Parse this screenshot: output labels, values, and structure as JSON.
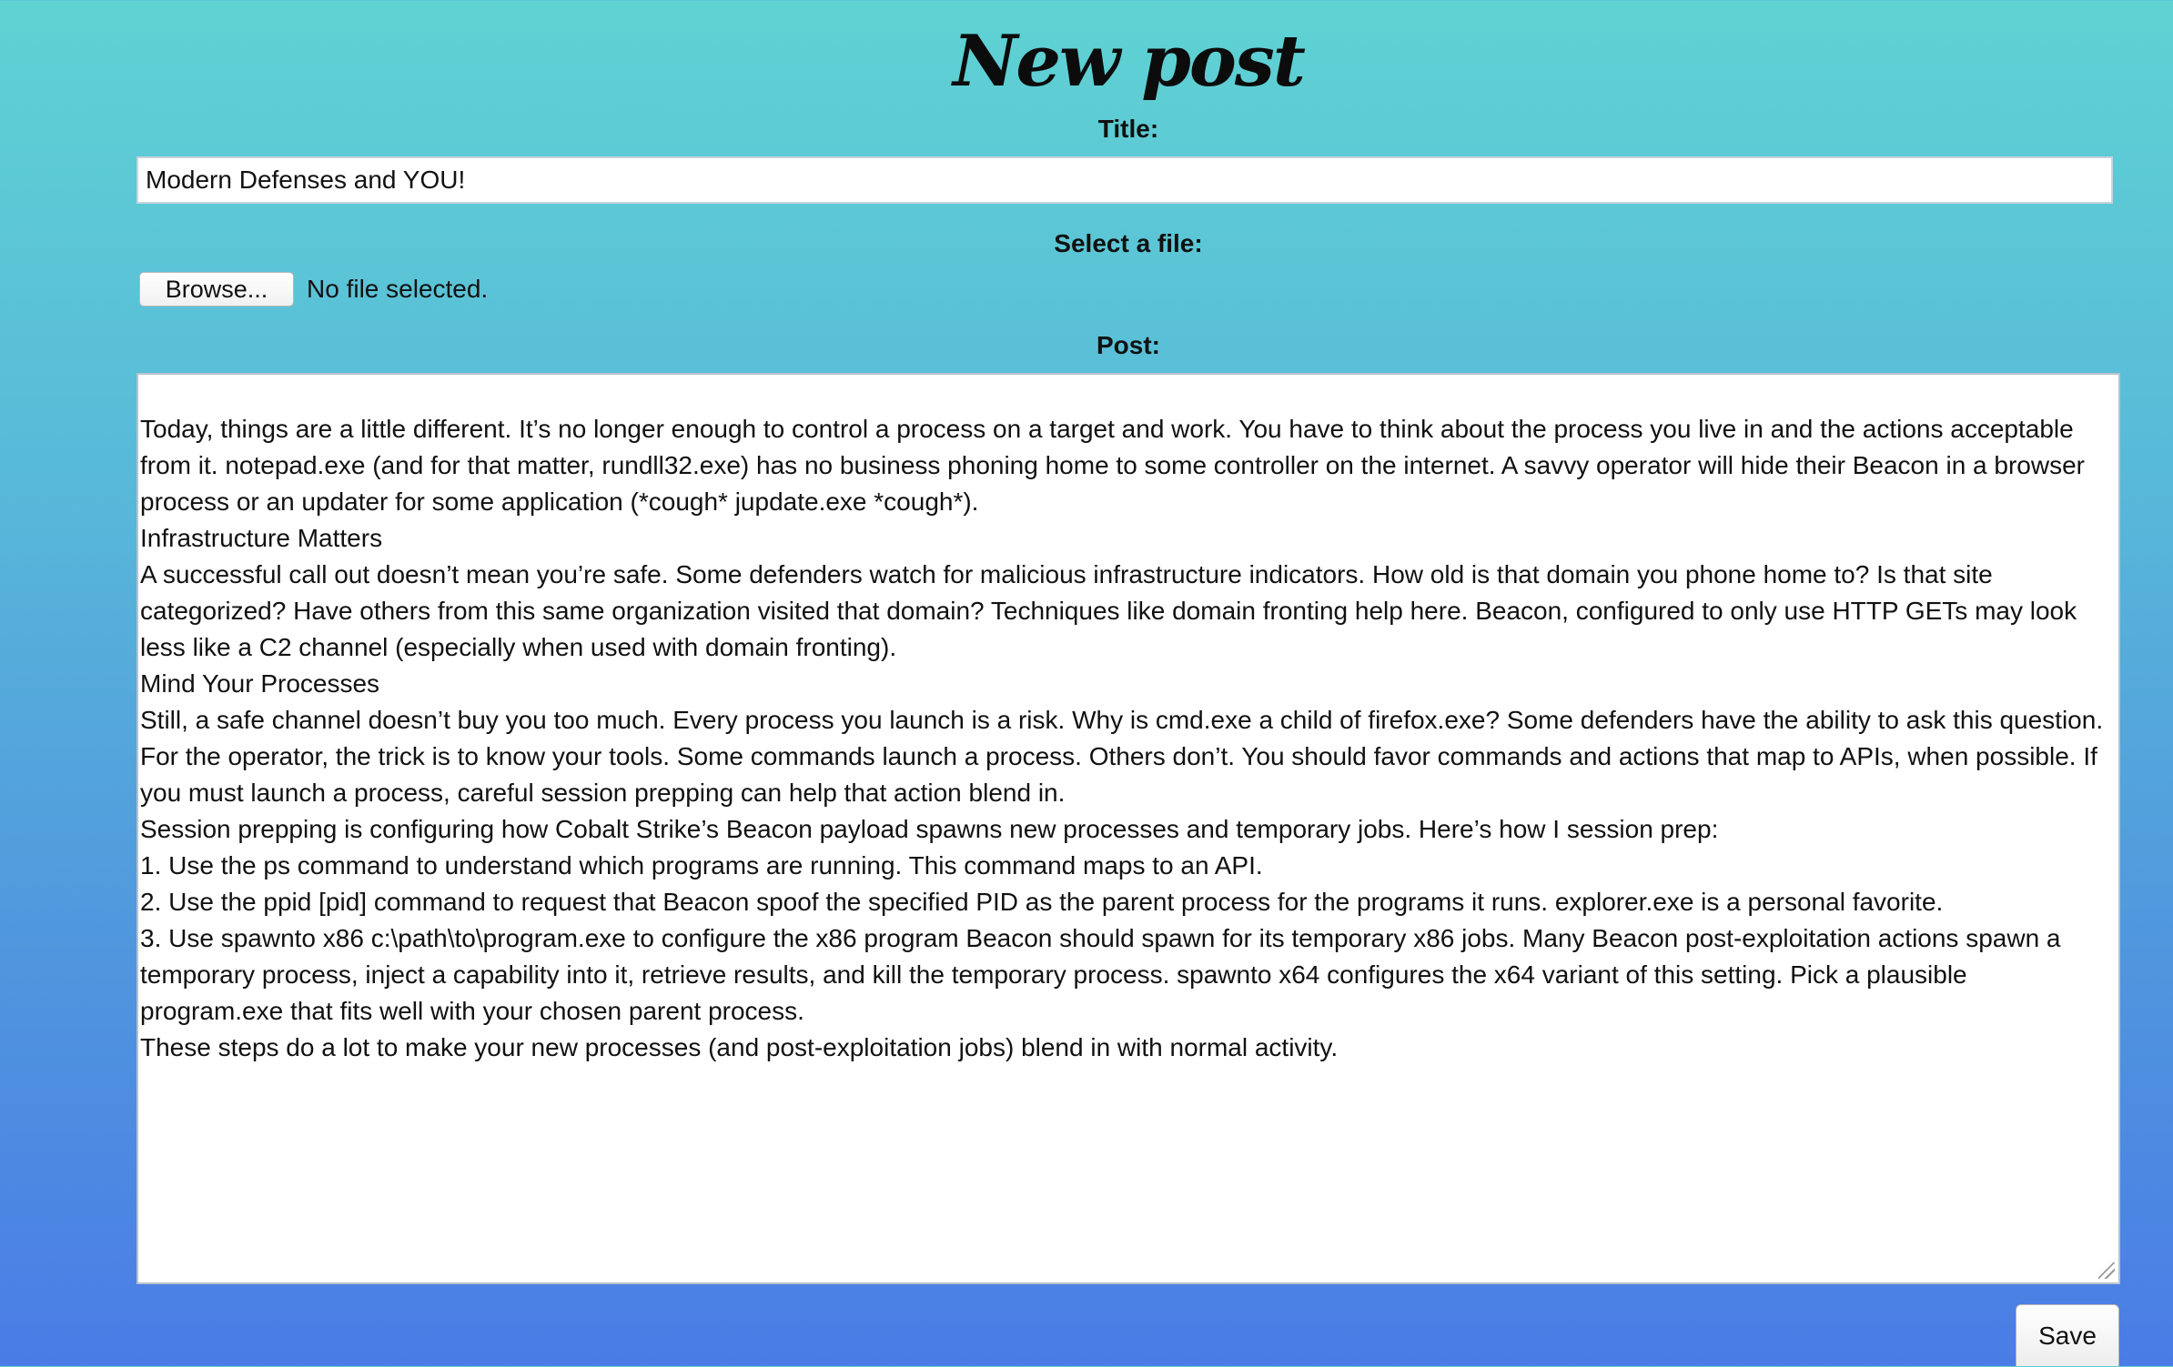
{
  "header": {
    "title": "New post"
  },
  "form": {
    "title_label": "Title:",
    "title_value": "Modern Defenses and YOU!",
    "file_label": "Select a file:",
    "browse_label": "Browse...",
    "file_status": "No file selected.",
    "post_label": "Post:",
    "post_paragraphs": [
      "Today, things are a little different. It’s no longer enough to control a process on a target and work. You have to think about the process you live in and the actions acceptable from it. notepad.exe (and for that matter, rundll32.exe) has no business phoning home to some controller on the internet. A savvy operator will hide their Beacon in a browser process or an updater for some application (*cough* jupdate.exe *cough*).",
      "Infrastructure Matters",
      "",
      "A successful call out doesn’t mean you’re safe. Some defenders watch for malicious infrastructure indicators. How old is that domain you phone home to? Is that site categorized? Have others from this same organization visited that domain? Techniques like domain fronting help here. Beacon, configured to only use HTTP GETs may look less like a C2 channel (especially when used with domain fronting).",
      "Mind Your Processes",
      "",
      "Still, a safe channel doesn’t buy you too much. Every process you launch is a risk. Why is cmd.exe a child of firefox.exe? Some defenders have the ability to ask this question. For the operator, the trick is to know your tools. Some commands launch a process. Others don’t. You should favor commands and actions that map to APIs, when possible. If you must launch a process, careful session prepping can help that action blend in.",
      "",
      "Session prepping is configuring how Cobalt Strike’s Beacon payload spawns new processes and temporary jobs. Here’s how I session prep:",
      "",
      "1. Use the ps command to understand which programs are running. This command maps to an API.",
      "2. Use the ppid [pid] command to request that Beacon spoof the specified PID as the parent process for the programs it runs. explorer.exe is a personal favorite.",
      "3. Use spawnto x86 c:\\path\\to\\program.exe to configure the x86 program Beacon should spawn for its temporary x86 jobs. Many Beacon post-exploitation actions spawn a temporary process, inject a capability into it, retrieve results, and kill the temporary process. spawnto x64 configures the x64 variant of this setting. Pick a plausible program.exe that fits well with your chosen parent process.",
      "",
      "These steps do a lot to make your new processes (and post-exploitation jobs) blend in with normal activity."
    ],
    "save_label": "Save"
  }
}
